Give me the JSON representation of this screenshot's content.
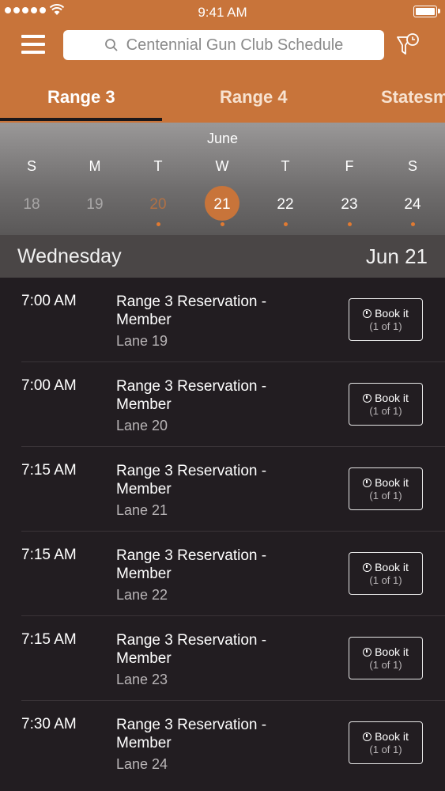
{
  "status_bar": {
    "time": "9:41 AM",
    "icons": [
      "signal-dots-icon",
      "wifi-icon",
      "battery-icon"
    ]
  },
  "header": {
    "search_text": "Centennial Gun Club Schedule",
    "icons": [
      "menu-icon",
      "search-icon",
      "filter-clock-icon"
    ],
    "tabs": [
      {
        "label": "Range 3",
        "active": true
      },
      {
        "label": "Range 4",
        "active": false
      },
      {
        "label": "Statesm",
        "active": false
      }
    ]
  },
  "calendar": {
    "month": "June",
    "weekdays": [
      "S",
      "M",
      "T",
      "W",
      "T",
      "F",
      "S"
    ],
    "days": [
      {
        "num": "18",
        "state": "past",
        "has_event": false
      },
      {
        "num": "19",
        "state": "past",
        "has_event": false
      },
      {
        "num": "20",
        "state": "past-event",
        "has_event": true
      },
      {
        "num": "21",
        "state": "selected",
        "has_event": true
      },
      {
        "num": "22",
        "state": "future",
        "has_event": true
      },
      {
        "num": "23",
        "state": "future",
        "has_event": true
      },
      {
        "num": "24",
        "state": "future",
        "has_event": true
      }
    ]
  },
  "date_header": {
    "weekday": "Wednesday",
    "date": "Jun 21"
  },
  "reservations": [
    {
      "time": "7:00 AM",
      "title": "Range 3 Reservation - Member",
      "lane": "Lane 19",
      "button": "Book it",
      "availability": "(1 of 1)"
    },
    {
      "time": "7:00 AM",
      "title": "Range 3 Reservation - Member",
      "lane": "Lane 20",
      "button": "Book it",
      "availability": "(1 of 1)"
    },
    {
      "time": "7:15 AM",
      "title": "Range 3 Reservation - Member",
      "lane": "Lane 21",
      "button": "Book it",
      "availability": "(1 of 1)"
    },
    {
      "time": "7:15 AM",
      "title": "Range 3 Reservation - Member",
      "lane": "Lane 22",
      "button": "Book it",
      "availability": "(1 of 1)"
    },
    {
      "time": "7:15 AM",
      "title": "Range 3 Reservation - Member",
      "lane": "Lane 23",
      "button": "Book it",
      "availability": "(1 of 1)"
    },
    {
      "time": "7:30 AM",
      "title": "Range 3 Reservation - Member",
      "lane": "Lane 24",
      "button": "Book it",
      "availability": "(1 of 1)"
    }
  ],
  "colors": {
    "accent": "#c8743a",
    "background": "#221d21"
  }
}
